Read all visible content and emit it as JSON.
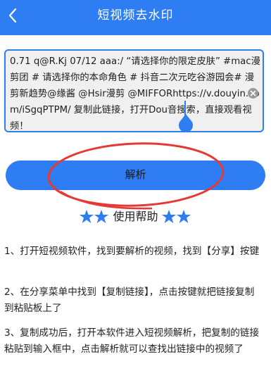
{
  "header": {
    "title": "短视频去水印",
    "back_icon": "chevron-left-icon"
  },
  "colors": {
    "primary": "#2f7df2",
    "annotation_red": "#e53935",
    "input_bg": "#f0f0f0"
  },
  "input": {
    "value": "0.71 q@R.Kj 07/12 aaa:/ “请选择你的限定皮肤” #mac漫剪团 # 请选择你的本命角色 # 抖音二次元吃谷游园会# 漫剪新趋势@缘酱 @Hsir漫剪 @MIFFORhttps://v.douyin.com/iSgqPTPM/ 复制此链接，打开Dou音搜索，直接观看视频！",
    "clear_icon": "clear-circle-icon"
  },
  "parse_button": {
    "label": "解析"
  },
  "help": {
    "title": "使用帮助",
    "star_icon": "star-icon",
    "steps": [
      "1、打开短视频软件，找到要解析的视频，找到【分享】按键",
      "2、在分享菜单中找到【复制链接】，点击按键就把链接复制到粘贴板上了",
      "3、复制成功后，打开本软件进入短视频解析，把复制的链接粘贴到输入框中，点击解析就可以查找出链接中的视频了"
    ]
  }
}
